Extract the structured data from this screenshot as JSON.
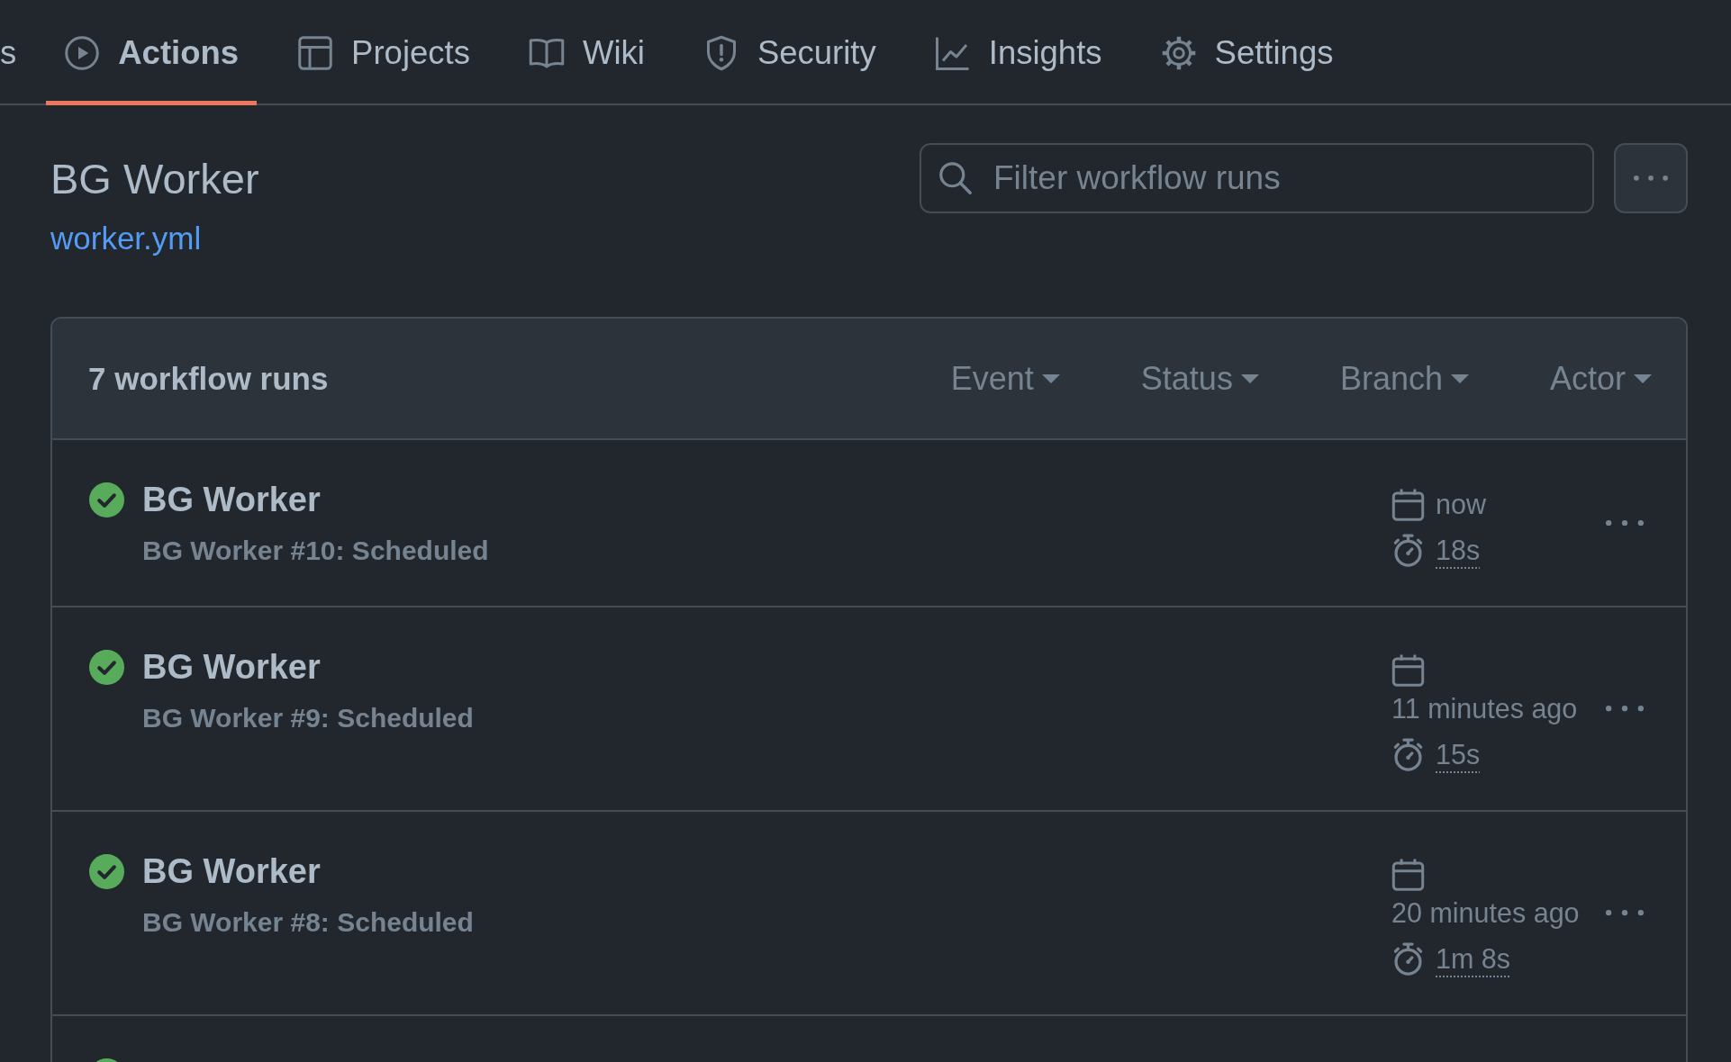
{
  "tabs": [
    {
      "label": "s",
      "selected": false
    },
    {
      "label": "Actions",
      "selected": true
    },
    {
      "label": "Projects",
      "selected": false
    },
    {
      "label": "Wiki",
      "selected": false
    },
    {
      "label": "Security",
      "selected": false
    },
    {
      "label": "Insights",
      "selected": false
    },
    {
      "label": "Settings",
      "selected": false
    }
  ],
  "workflow": {
    "title": "BG Worker",
    "file_link": "worker.yml"
  },
  "search": {
    "placeholder": "Filter workflow runs"
  },
  "runs": {
    "count": "7 workflow runs",
    "filters": [
      {
        "label": "Event"
      },
      {
        "label": "Status"
      },
      {
        "label": "Branch"
      },
      {
        "label": "Actor"
      }
    ],
    "rows": [
      {
        "success": true,
        "title": "BG Worker",
        "description": "BG Worker #10: Scheduled",
        "date": "now",
        "duration": "18s"
      },
      {
        "success": true,
        "title": "BG Worker",
        "description": "BG Worker #9: Scheduled",
        "date": "11 minutes ago",
        "duration": "15s"
      },
      {
        "success": true,
        "title": "BG Worker",
        "description": "BG Worker #8: Scheduled",
        "date": "20 minutes ago",
        "duration": "1m 8s"
      },
      {
        "success": true
      }
    ]
  }
}
